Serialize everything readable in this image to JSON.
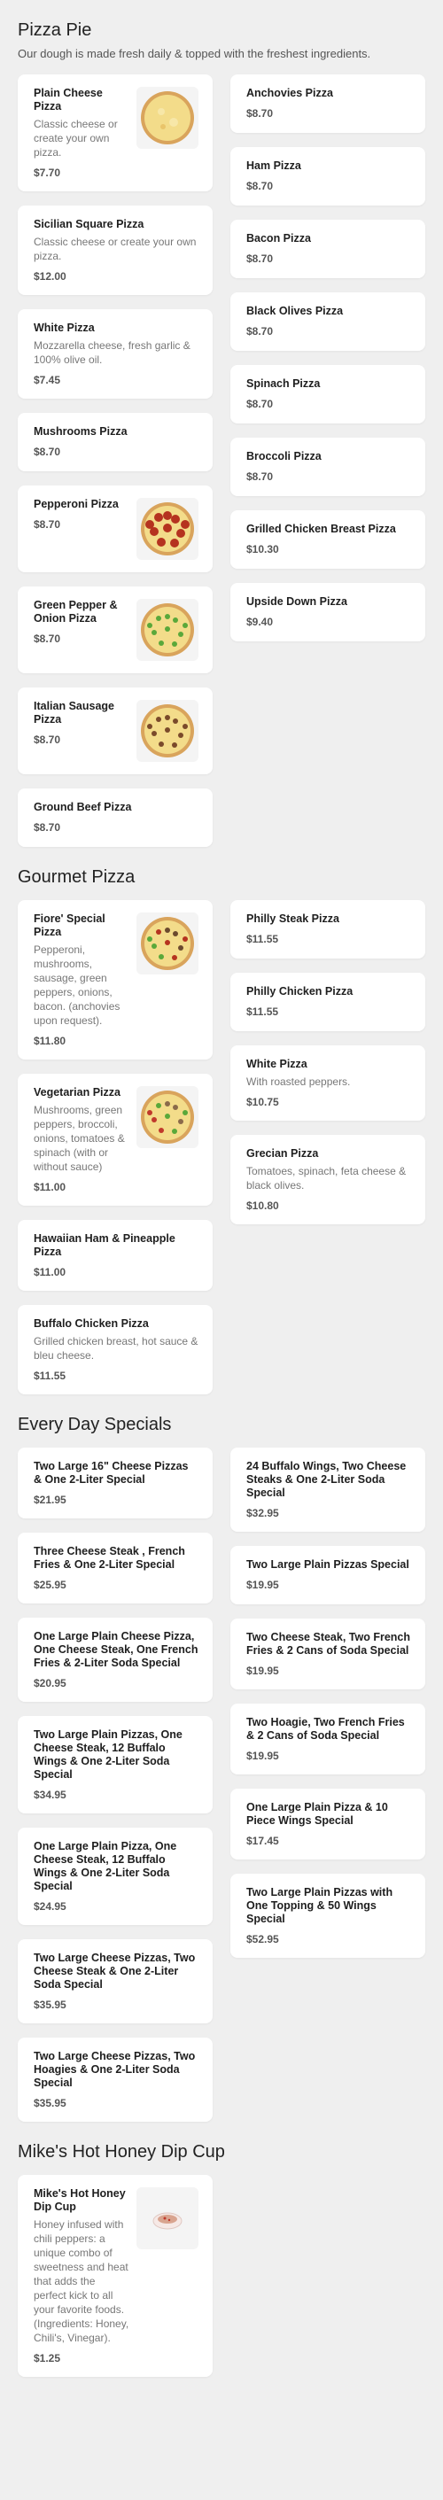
{
  "sections": [
    {
      "title": "Pizza Pie",
      "description": "Our dough is made fresh daily & topped with the freshest ingredients.",
      "left": [
        {
          "name": "Plain Cheese Pizza",
          "desc": "Classic cheese or create your own pizza.",
          "price": "$7.70",
          "image": "cheese"
        },
        {
          "name": "Sicilian Square Pizza",
          "desc": "Classic cheese or create your own pizza.",
          "price": "$12.00"
        },
        {
          "name": "White Pizza",
          "desc": "Mozzarella cheese, fresh garlic & 100% olive oil.",
          "price": "$7.45"
        },
        {
          "name": "Mushrooms Pizza",
          "desc": "",
          "price": "$8.70"
        },
        {
          "name": "Pepperoni Pizza",
          "desc": "",
          "price": "$8.70",
          "image": "pepperoni"
        },
        {
          "name": "Green Pepper & Onion Pizza",
          "desc": "",
          "price": "$8.70",
          "image": "greenpepper"
        },
        {
          "name": "Italian Sausage Pizza",
          "desc": "",
          "price": "$8.70",
          "image": "sausage"
        },
        {
          "name": "Ground Beef Pizza",
          "desc": "",
          "price": "$8.70"
        }
      ],
      "right": [
        {
          "name": "Anchovies Pizza",
          "desc": "",
          "price": "$8.70"
        },
        {
          "name": "Ham Pizza",
          "desc": "",
          "price": "$8.70"
        },
        {
          "name": "Bacon Pizza",
          "desc": "",
          "price": "$8.70"
        },
        {
          "name": "Black Olives Pizza",
          "desc": "",
          "price": "$8.70"
        },
        {
          "name": "Spinach Pizza",
          "desc": "",
          "price": "$8.70"
        },
        {
          "name": "Broccoli Pizza",
          "desc": "",
          "price": "$8.70"
        },
        {
          "name": "Grilled Chicken Breast Pizza",
          "desc": "",
          "price": "$10.30"
        },
        {
          "name": "Upside Down Pizza",
          "desc": "",
          "price": "$9.40"
        }
      ]
    },
    {
      "title": "Gourmet Pizza",
      "description": "",
      "left": [
        {
          "name": "Fiore' Special Pizza",
          "desc": "Pepperoni, mushrooms, sausage, green peppers, onions, bacon. (anchovies upon request).",
          "price": "$11.80",
          "image": "special"
        },
        {
          "name": "Vegetarian Pizza",
          "desc": "Mushrooms, green peppers, broccoli, onions, tomatoes & spinach (with or without sauce)",
          "price": "$11.00",
          "image": "veg"
        },
        {
          "name": "Hawaiian Ham & Pineapple Pizza",
          "desc": "",
          "price": "$11.00"
        },
        {
          "name": "Buffalo Chicken Pizza",
          "desc": "Grilled chicken breast, hot sauce & bleu cheese.",
          "price": "$11.55"
        }
      ],
      "right": [
        {
          "name": "Philly Steak Pizza",
          "desc": "",
          "price": "$11.55"
        },
        {
          "name": "Philly Chicken Pizza",
          "desc": "",
          "price": "$11.55"
        },
        {
          "name": "White Pizza",
          "desc": "With roasted peppers.",
          "price": "$10.75"
        },
        {
          "name": "Grecian Pizza",
          "desc": "Tomatoes, spinach, feta cheese & black olives.",
          "price": "$10.80"
        }
      ]
    },
    {
      "title": "Every Day Specials",
      "description": "",
      "left": [
        {
          "name": "Two Large 16\" Cheese Pizzas & One 2-Liter Special",
          "desc": "",
          "price": "$21.95"
        },
        {
          "name": "Three Cheese Steak , French Fries & One 2-Liter Special",
          "desc": "",
          "price": "$25.95"
        },
        {
          "name": "One Large Plain Cheese Pizza, One Cheese Steak, One French Fries & 2-Liter Soda Special",
          "desc": "",
          "price": "$20.95"
        },
        {
          "name": "Two Large Plain Pizzas, One Cheese Steak, 12 Buffalo Wings & One 2-Liter Soda Special",
          "desc": "",
          "price": "$34.95"
        },
        {
          "name": "One Large Plain Pizza, One Cheese Steak, 12 Buffalo Wings & One 2-Liter Soda Special",
          "desc": "",
          "price": "$24.95"
        },
        {
          "name": "Two Large Cheese Pizzas, Two Cheese Steak & One 2-Liter Soda Special",
          "desc": "",
          "price": "$35.95"
        },
        {
          "name": "Two Large Cheese Pizzas, Two Hoagies & One 2-Liter Soda Special",
          "desc": "",
          "price": "$35.95"
        }
      ],
      "right": [
        {
          "name": "24 Buffalo Wings, Two Cheese Steaks & One 2-Liter Soda Special",
          "desc": "",
          "price": "$32.95"
        },
        {
          "name": "Two Large Plain Pizzas Special",
          "desc": "",
          "price": "$19.95"
        },
        {
          "name": "Two Cheese Steak, Two French Fries & 2 Cans of Soda Special",
          "desc": "",
          "price": "$19.95"
        },
        {
          "name": "Two Hoagie, Two French Fries & 2 Cans of Soda Special",
          "desc": "",
          "price": "$19.95"
        },
        {
          "name": "One Large Plain Pizza & 10 Piece Wings Special",
          "desc": "",
          "price": "$17.45"
        },
        {
          "name": "Two Large Plain Pizzas with One Topping & 50 Wings Special",
          "desc": "",
          "price": "$52.95"
        }
      ]
    },
    {
      "title": "Mike's Hot Honey Dip Cup",
      "description": "",
      "left": [
        {
          "name": "Mike's Hot Honey Dip Cup",
          "desc": "Honey infused with chili peppers: a unique combo of sweetness and heat that adds the perfect kick to all your favorite foods. (Ingredients: Honey, Chili's, Vinegar).",
          "price": "$1.25",
          "image": "dipcup"
        }
      ],
      "right": []
    }
  ]
}
